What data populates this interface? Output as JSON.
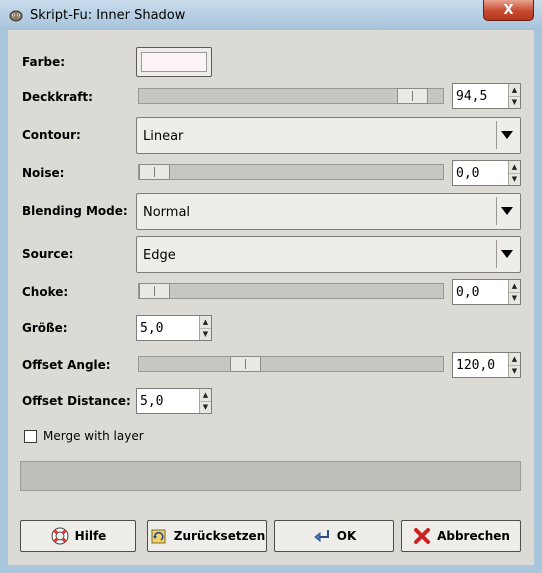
{
  "window": {
    "title": "Skript-Fu: Inner Shadow",
    "close_label": "X"
  },
  "labels": {
    "farbe": "Farbe:",
    "deckkraft": "Deckkraft:",
    "contour": "Contour:",
    "noise": "Noise:",
    "blending_mode": "Blending Mode:",
    "source": "Source:",
    "choke": "Choke:",
    "groesse": "Größe:",
    "offset_angle": "Offset Angle:",
    "offset_distance": "Offset Distance:"
  },
  "values": {
    "deckkraft": "94,5",
    "contour": "Linear",
    "noise": "0,0",
    "blending_mode": "Normal",
    "source": "Edge",
    "choke": "0,0",
    "groesse": "5,0",
    "offset_angle": "120,0",
    "offset_distance": "5,0"
  },
  "slider_levels": {
    "deckkraft": 0.945,
    "noise": 0.0,
    "choke": 0.0,
    "offset_angle": 0.333
  },
  "colors": {
    "farbe_swatch": "#fcf4f4",
    "close_button": "#c74a31"
  },
  "merge": {
    "label": "Merge with layer",
    "checked": false
  },
  "buttons": {
    "help": "Hilfe",
    "reset": "Zurücksetzen",
    "ok": "OK",
    "cancel": "Abbrechen"
  },
  "icons": {
    "help": "lifebuoy-icon",
    "reset": "reset-icon",
    "ok": "ok-arrow-icon",
    "cancel": "cancel-x-icon",
    "title": "gimp-icon"
  }
}
